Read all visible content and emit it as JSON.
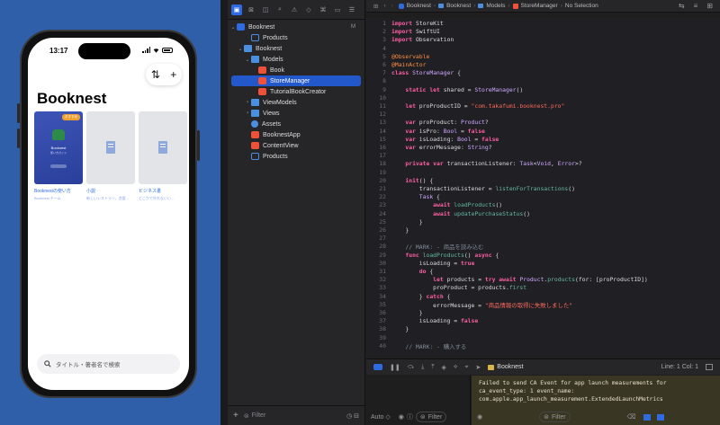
{
  "simulator": {
    "time": "13:17",
    "title": "Booknest",
    "books": [
      {
        "title": "Booknestの使い方",
        "author": "Booknest チーム",
        "featured": true,
        "tag": "おすすめ",
        "cover_title": "Booknest",
        "cover_sub": "使い方ガイド"
      },
      {
        "title": "小説",
        "author": "新しいレストラン、恋愛..."
      },
      {
        "title": "ビジネス書",
        "author": "どこかで外れないい..."
      }
    ],
    "search_placeholder": "タイトル・著者名で検索"
  },
  "navigator": {
    "project": "Booknest",
    "project_badge": "M",
    "items": [
      {
        "label": "Products",
        "kind": "products",
        "indent": 2
      },
      {
        "label": "Booknest",
        "kind": "folder",
        "indent": 1,
        "chev": "⌄"
      },
      {
        "label": "Models",
        "kind": "folder",
        "indent": 2,
        "chev": "⌄"
      },
      {
        "label": "Book",
        "kind": "swift",
        "indent": 3
      },
      {
        "label": "StoreManager",
        "kind": "swift",
        "indent": 3,
        "selected": true
      },
      {
        "label": "TutorialBookCreator",
        "kind": "swift",
        "indent": 3
      },
      {
        "label": "ViewModels",
        "kind": "folder",
        "indent": 2,
        "chev": "›"
      },
      {
        "label": "Views",
        "kind": "folder",
        "indent": 2,
        "chev": "›"
      },
      {
        "label": "Assets",
        "kind": "assets",
        "indent": 2
      },
      {
        "label": "BooknestApp",
        "kind": "swift",
        "indent": 2
      },
      {
        "label": "ContentView",
        "kind": "swift",
        "indent": 2
      },
      {
        "label": "Products",
        "kind": "products",
        "indent": 2
      }
    ],
    "filter_placeholder": "Filter"
  },
  "breadcrumb": [
    "Booknest",
    "Booknest",
    "Models",
    "StoreManager",
    "No Selection"
  ],
  "code": {
    "lines": [
      {
        "n": "1",
        "html": "<span class='kw'>import</span> StoreKit"
      },
      {
        "n": "2",
        "html": "<span class='kw'>import</span> SwiftUI"
      },
      {
        "n": "3",
        "html": "<span class='kw'>import</span> Observation"
      },
      {
        "n": "4",
        "html": ""
      },
      {
        "n": "5",
        "html": "<span class='at'>@Observable</span>"
      },
      {
        "n": "6",
        "html": "<span class='at'>@MainActor</span>"
      },
      {
        "n": "7",
        "html": "<span class='kw'>class</span> <span class='ty'>StoreManager</span> {"
      },
      {
        "n": "8",
        "html": ""
      },
      {
        "n": "9",
        "html": "    <span class='kw'>static let</span> shared = <span class='ty'>StoreManager</span>()"
      },
      {
        "n": "10",
        "html": ""
      },
      {
        "n": "11",
        "html": "    <span class='kw'>let</span> proProductID = <span class='st'>\"com.takafumi.booknest.pro\"</span>"
      },
      {
        "n": "12",
        "html": ""
      },
      {
        "n": "13",
        "html": "    <span class='kw'>var</span> proProduct: <span class='ty'>Product</span>?"
      },
      {
        "n": "14",
        "html": "    <span class='kw'>var</span> isPro: <span class='ty'>Bool</span> = <span class='kw'>false</span>"
      },
      {
        "n": "15",
        "html": "    <span class='kw'>var</span> isLoading: <span class='ty'>Bool</span> = <span class='kw'>false</span>"
      },
      {
        "n": "16",
        "html": "    <span class='kw'>var</span> errorMessage: <span class='ty'>String</span>?"
      },
      {
        "n": "17",
        "html": ""
      },
      {
        "n": "18",
        "html": "    <span class='kw'>private var</span> transactionListener: <span class='ty'>Task</span>&lt;<span class='ty'>Void</span>, <span class='ty'>Error</span>&gt;?"
      },
      {
        "n": "19",
        "html": ""
      },
      {
        "n": "20",
        "html": "    <span class='kw'>init</span>() {"
      },
      {
        "n": "21",
        "html": "        transactionListener = <span class='fn'>listenForTransactions</span>()"
      },
      {
        "n": "22",
        "html": "        <span class='ty'>Task</span> {"
      },
      {
        "n": "23",
        "html": "            <span class='kw'>await</span> <span class='fn'>loadProducts</span>()"
      },
      {
        "n": "24",
        "html": "            <span class='kw'>await</span> <span class='fn'>updatePurchaseStatus</span>()"
      },
      {
        "n": "25",
        "html": "        }"
      },
      {
        "n": "26",
        "html": "    }"
      },
      {
        "n": "27",
        "html": ""
      },
      {
        "n": "28",
        "html": "    <span class='cm'>// MARK: - 商品を読み込む</span>"
      },
      {
        "n": "29",
        "html": "    <span class='kw'>func</span> <span class='fn'>loadProducts</span>() <span class='kw'>async</span> {"
      },
      {
        "n": "30",
        "html": "        isLoading = <span class='kw'>true</span>"
      },
      {
        "n": "31",
        "html": "        <span class='kw'>do</span> {"
      },
      {
        "n": "32",
        "html": "            <span class='kw'>let</span> products = <span class='kw'>try await</span> <span class='ty'>Product</span>.<span class='fn'>products</span>(for: [proProductID])"
      },
      {
        "n": "33",
        "html": "            proProduct = products.<span class='fn'>first</span>"
      },
      {
        "n": "34",
        "html": "        } <span class='kw'>catch</span> {"
      },
      {
        "n": "35",
        "html": "            errorMessage = <span class='st'>\"商品情報の取得に失敗しました\"</span>"
      },
      {
        "n": "36",
        "html": "        }"
      },
      {
        "n": "37",
        "html": "        isLoading = <span class='kw'>false</span>"
      },
      {
        "n": "38",
        "html": "    }"
      },
      {
        "n": "39",
        "html": ""
      },
      {
        "n": "40",
        "html": "    <span class='cm'>// MARK: - 購入する</span>"
      }
    ]
  },
  "debug": {
    "scheme": "Booknest",
    "line_col": "Line: 1  Col: 1",
    "auto_label": "Auto ◇",
    "filter_placeholder": "Filter"
  },
  "console": {
    "text": "Failed to send CA Event for app launch measurements for\nca_event_type: 1 event_name:\ncom.apple.app_launch_measurement.ExtendedLaunchMetrics"
  }
}
